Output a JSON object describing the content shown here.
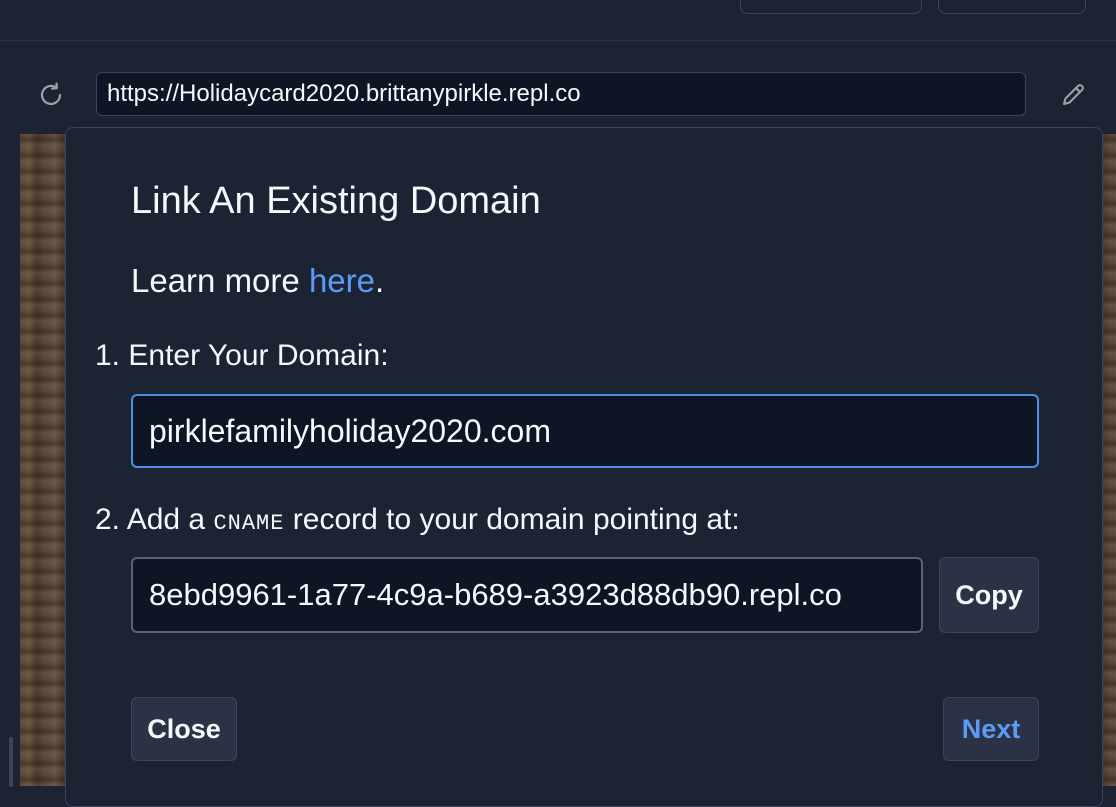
{
  "webview": {
    "url": "https://Holidaycard2020.brittanypirkle.repl.co",
    "reload_icon": "reload-icon",
    "edit_icon": "pencil-icon"
  },
  "modal": {
    "title": "Link An Existing Domain",
    "learn_more_prefix": "Learn more ",
    "learn_more_link": "here",
    "learn_more_suffix": ".",
    "step1": {
      "number": "1.",
      "label": "Enter Your Domain:",
      "domain_value": "pirklefamilyholiday2020.com"
    },
    "step2": {
      "number": "2.",
      "label_prefix": "Add a ",
      "label_code": "CNAME",
      "label_suffix": " record to your domain pointing at:",
      "target_value": "8ebd9961-1a77-4c9a-b689-a3923d88db90.repl.co",
      "copy_label": "Copy"
    },
    "close_label": "Close",
    "next_label": "Next"
  },
  "colors": {
    "background": "#1c2333",
    "input_background": "#0e1525",
    "accent": "#5b9bf8",
    "focus_border": "#4e8ee8",
    "text": "#f5f9fc"
  }
}
